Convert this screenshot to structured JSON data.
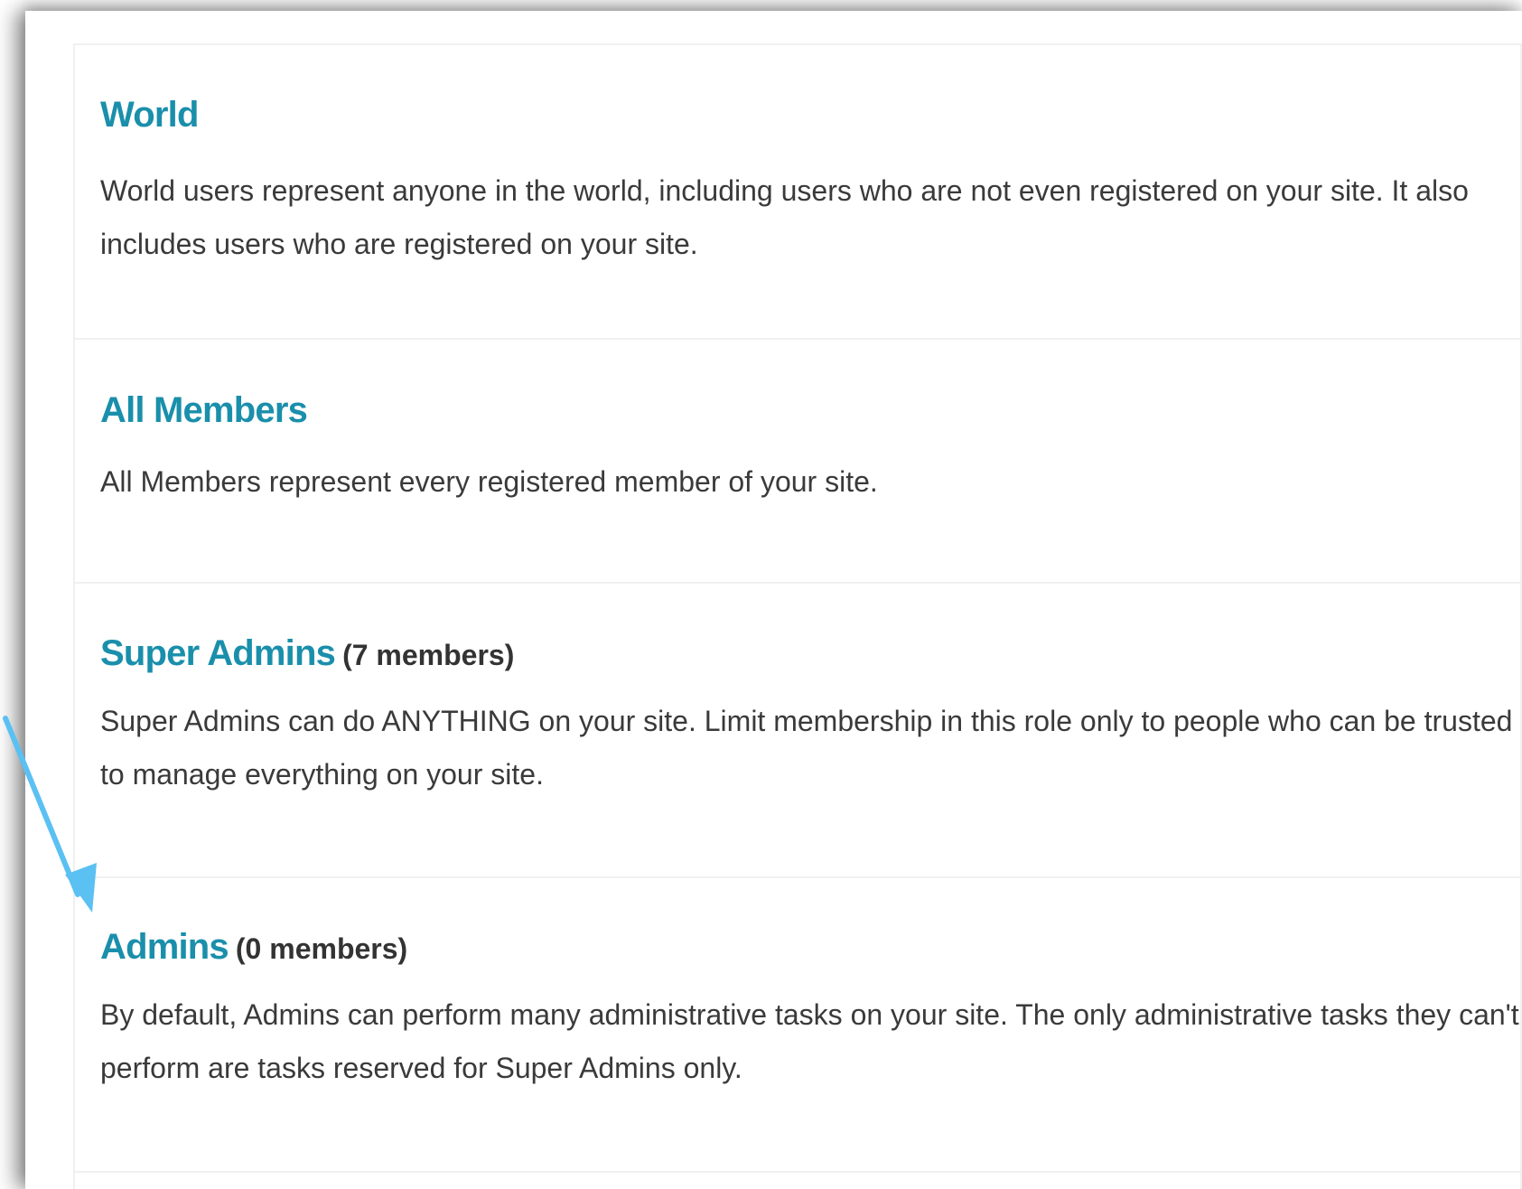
{
  "roles": [
    {
      "name": "World",
      "member_count": "",
      "description": "World users represent anyone in the world, including users who are not even registered on your site. It also includes users who are registered on your site."
    },
    {
      "name": "All Members",
      "member_count": "",
      "description": "All Members represent every registered member of your site."
    },
    {
      "name": "Super Admins",
      "member_count": "(7 members)",
      "description": "Super Admins can do ANYTHING on your site. Limit membership in this role only to people who can be trusted to manage everything on your site."
    },
    {
      "name": "Admins",
      "member_count": "(0 members)",
      "description": "By default, Admins can perform many administrative tasks on your site. The only administrative tasks they can't perform are tasks reserved for Super Admins only."
    }
  ],
  "colors": {
    "role_link": "#1a8fab",
    "annotation_arrow": "#5bc0f2",
    "card_border": "#f0f0f0"
  }
}
